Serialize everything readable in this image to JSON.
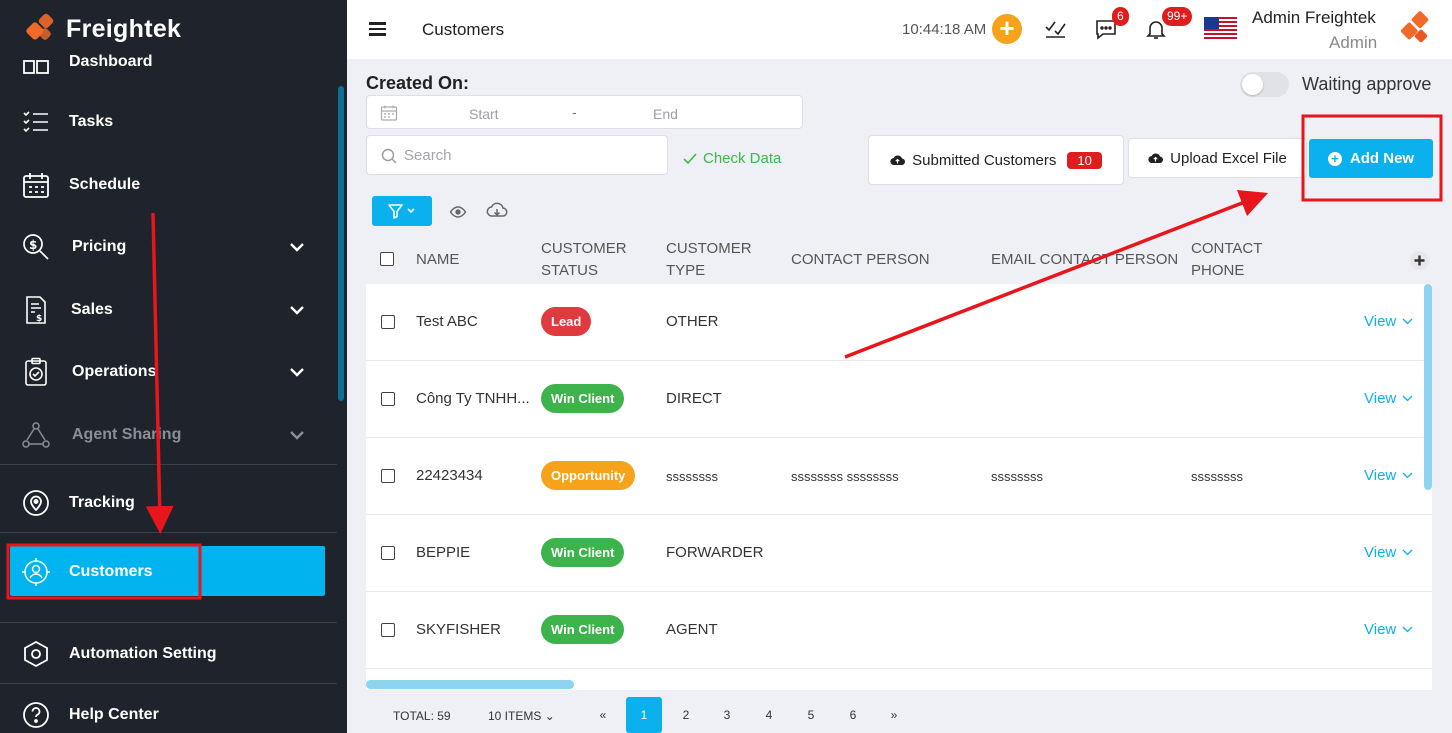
{
  "app": {
    "name": "Freightek"
  },
  "sidebar": {
    "items": [
      {
        "label": "Dashboard",
        "icon": "dashboard-icon"
      },
      {
        "label": "Tasks",
        "icon": "tasks-icon"
      },
      {
        "label": "Schedule",
        "icon": "calendar-icon"
      },
      {
        "label": "Pricing",
        "icon": "pricing-search-icon"
      },
      {
        "label": "Sales",
        "icon": "invoice-icon"
      },
      {
        "label": "Operations",
        "icon": "clipboard-check-icon"
      },
      {
        "label": "Agent Sharing",
        "icon": "agent-sharing-icon"
      },
      {
        "label": "Tracking",
        "icon": "location-pin-icon"
      },
      {
        "label": "Customers",
        "icon": "customer-icon"
      },
      {
        "label": "Automation Setting",
        "icon": "hexagon-gear-icon"
      },
      {
        "label": "Help Center",
        "icon": "help-icon"
      }
    ],
    "active": "Customers"
  },
  "header": {
    "page_title": "Customers",
    "clock": "10:44:18 AM",
    "messages_badge": "6",
    "notifications_badge": "99+",
    "user_name": "Admin Freightek",
    "user_role": "Admin"
  },
  "filters": {
    "created_on_label": "Created On:",
    "date_start_placeholder": "Start",
    "date_separator": "-",
    "date_end_placeholder": "End",
    "search_placeholder": "Search",
    "check_data_label": "Check Data",
    "waiting_approve_label": "Waiting approve",
    "waiting_approve_on": false
  },
  "actions": {
    "submitted_label": "Submitted Customers",
    "submitted_count": "10",
    "upload_label": "Upload Excel File",
    "add_new_label": "Add New"
  },
  "table": {
    "headers": {
      "name": "NAME",
      "status_line1": "CUSTOMER",
      "status_line2": "STATUS",
      "type_line1": "CUSTOMER",
      "type_line2": "TYPE",
      "contact": "CONTACT PERSON",
      "email": "EMAIL CONTACT PERSON",
      "phone_line1": "CONTACT",
      "phone_line2": "PHONE"
    },
    "view_label": "View",
    "rows": [
      {
        "name": "Test ABC",
        "status": "Lead",
        "status_color": "#e0393e",
        "type": "OTHER",
        "contact": "",
        "email": "",
        "phone": ""
      },
      {
        "name": "Công Ty TNHH...",
        "status": "Win Client",
        "status_color": "#3cb44b",
        "type": "DIRECT",
        "contact": "",
        "email": "",
        "phone": ""
      },
      {
        "name": "22423434",
        "status": "Opportunity",
        "status_color": "#f7a21b",
        "type": "ssssssss",
        "contact": "ssssssss ssssssss",
        "email": "ssssssss",
        "phone": "ssssssss"
      },
      {
        "name": "BEPPIE",
        "status": "Win Client",
        "status_color": "#3cb44b",
        "type": "FORWARDER",
        "contact": "",
        "email": "",
        "phone": ""
      },
      {
        "name": "SKYFISHER",
        "status": "Win Client",
        "status_color": "#3cb44b",
        "type": "AGENT",
        "contact": "",
        "email": "",
        "phone": ""
      }
    ]
  },
  "pagination": {
    "total": "TOTAL: 59",
    "per_page": "10 ITEMS",
    "prev": "«",
    "pages": [
      "1",
      "2",
      "3",
      "4",
      "5",
      "6"
    ],
    "next": "»",
    "current": "1"
  },
  "colors": {
    "accent": "#0ab1ec",
    "sidebar_bg": "#1f232b",
    "annotation": "#e8151b"
  }
}
